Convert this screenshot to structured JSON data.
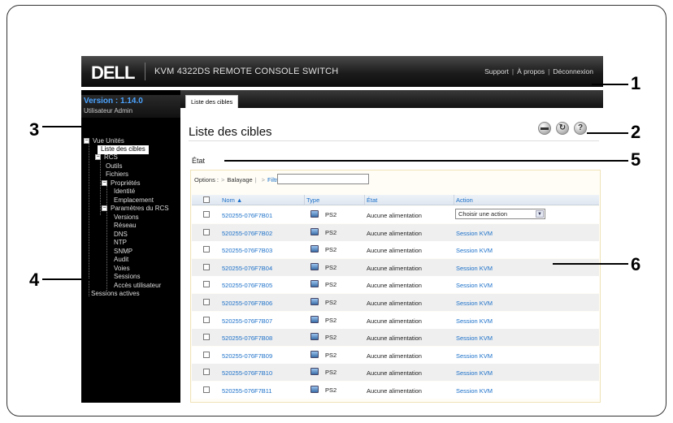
{
  "header": {
    "logo": "DELL",
    "product": "KVM 4322DS REMOTE CONSOLE SWITCH",
    "links": [
      "Support",
      "À propos",
      "Déconnexion"
    ]
  },
  "sidebar": {
    "version": "Version : 1.14.0",
    "user": "Utilisateur Admin",
    "tree": [
      {
        "label": "Vue Unités",
        "toggle": "−"
      },
      {
        "label": "Liste des cibles",
        "selected": true
      },
      {
        "label": "RCS",
        "toggle": "−"
      },
      {
        "label": "Outils"
      },
      {
        "label": "Fichiers"
      },
      {
        "label": "Propriétés",
        "toggle": "−"
      },
      {
        "label": "Identité"
      },
      {
        "label": "Emplacement"
      },
      {
        "label": "Paramètres du RCS",
        "toggle": "−"
      },
      {
        "label": "Versions"
      },
      {
        "label": "Réseau"
      },
      {
        "label": "DNS"
      },
      {
        "label": "NTP"
      },
      {
        "label": "SNMP"
      },
      {
        "label": "Audit"
      },
      {
        "label": "Voies"
      },
      {
        "label": "Sessions"
      },
      {
        "label": "Accès utilisateur"
      },
      {
        "label": "Sessions actives"
      }
    ]
  },
  "main": {
    "tab": "Liste des cibles",
    "title": "Liste des cibles",
    "subtitle": "État",
    "toolbar_icons": [
      "print-icon",
      "refresh-icon",
      "help-icon"
    ],
    "options": {
      "label": "Options :",
      "sweep": "Balayage",
      "filter": "Filtre",
      "filter_value": ""
    },
    "table": {
      "headers": [
        "Nom ▲",
        "Type",
        "État",
        "Action"
      ],
      "rows": [
        {
          "name": "520255-076F7B01",
          "type": "PS2",
          "state": "Aucune alimentation",
          "action": "Choisir une action"
        },
        {
          "name": "520255-076F7B02",
          "type": "PS2",
          "state": "Aucune alimentation",
          "action": "Session KVM"
        },
        {
          "name": "520255-076F7B03",
          "type": "PS2",
          "state": "Aucune alimentation",
          "action": "Session KVM"
        },
        {
          "name": "520255-076F7B04",
          "type": "PS2",
          "state": "Aucune alimentation",
          "action": "Session KVM"
        },
        {
          "name": "520255-076F7B05",
          "type": "PS2",
          "state": "Aucune alimentation",
          "action": "Session KVM"
        },
        {
          "name": "520255-076F7B06",
          "type": "PS2",
          "state": "Aucune alimentation",
          "action": "Session KVM"
        },
        {
          "name": "520255-076F7B07",
          "type": "PS2",
          "state": "Aucune alimentation",
          "action": "Session KVM"
        },
        {
          "name": "520255-076F7B08",
          "type": "PS2",
          "state": "Aucune alimentation",
          "action": "Session KVM"
        },
        {
          "name": "520255-076F7B09",
          "type": "PS2",
          "state": "Aucune alimentation",
          "action": "Session KVM"
        },
        {
          "name": "520255-076F7B10",
          "type": "PS2",
          "state": "Aucune alimentation",
          "action": "Session KVM"
        },
        {
          "name": "520255-076F7B11",
          "type": "PS2",
          "state": "Aucune alimentation",
          "action": "Session KVM"
        }
      ]
    }
  },
  "callouts": [
    "1",
    "2",
    "3",
    "4",
    "5",
    "6"
  ],
  "colors": {
    "link": "#1a6fc9",
    "version": "#4aa3ff",
    "sidebar_bg": "#000000"
  }
}
